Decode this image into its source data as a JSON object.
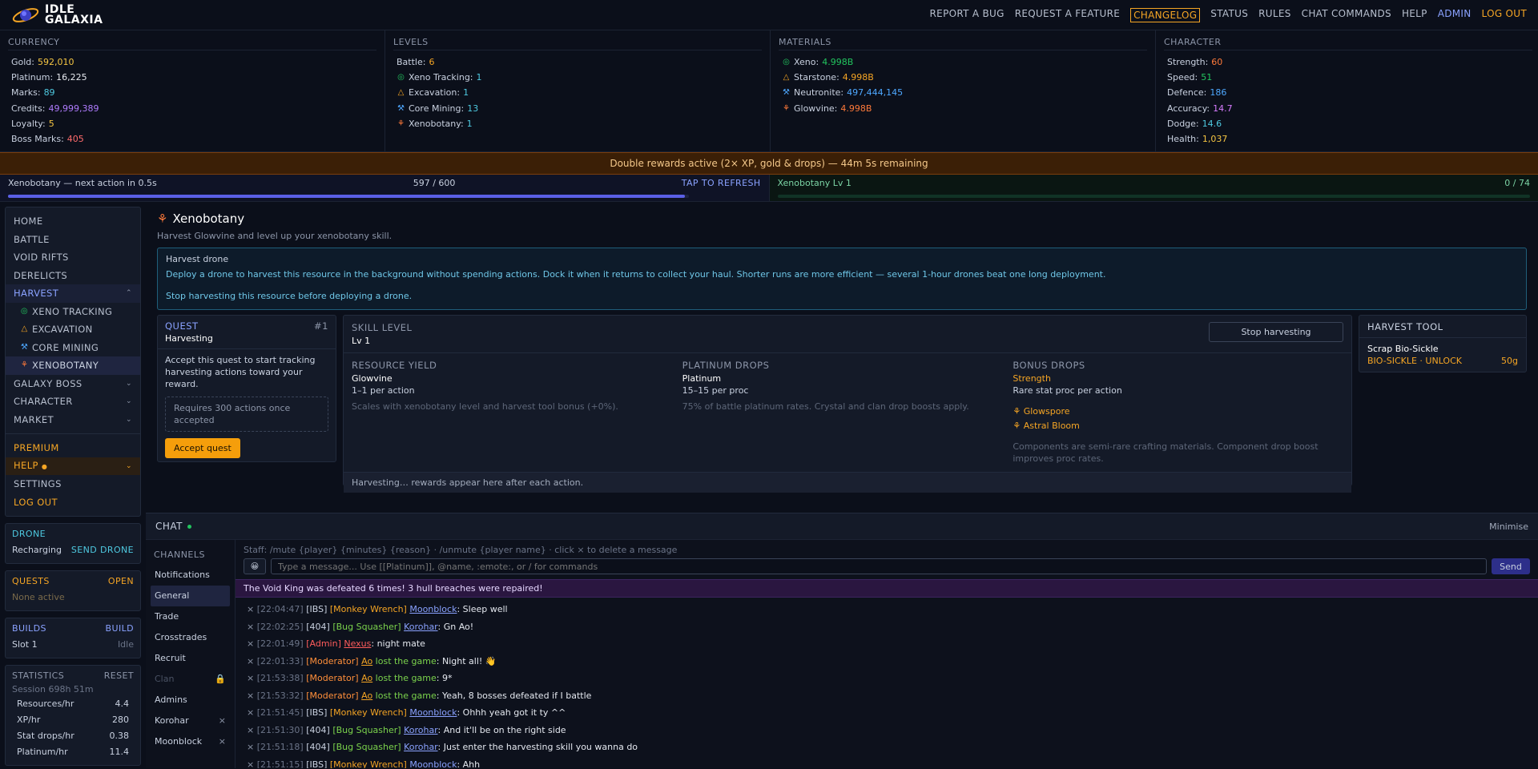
{
  "header": {
    "logo_line1": "IDLE",
    "logo_line2": "GALAXIA",
    "nav": [
      "REPORT A BUG",
      "REQUEST A FEATURE",
      "CHANGELOG",
      "STATUS",
      "RULES",
      "CHAT COMMANDS",
      "HELP",
      "ADMIN",
      "LOG OUT"
    ]
  },
  "stats": {
    "currency": {
      "title": "CURRENCY",
      "rows": [
        {
          "label": "Gold:",
          "value": "592,010",
          "color": "#f5c542"
        },
        {
          "label": "Platinum:",
          "value": "16,225",
          "color": "#e6e9ef"
        },
        {
          "label": "Marks:",
          "value": "89",
          "color": "#4ec9e0"
        },
        {
          "label": "Credits:",
          "value": "49,999,389",
          "color": "#b07cff"
        },
        {
          "label": "Loyalty:",
          "value": "5",
          "color": "#f5c542"
        },
        {
          "label": "Boss Marks:",
          "value": "405",
          "color": "#ff6b6b"
        }
      ]
    },
    "levels": {
      "title": "LEVELS",
      "rows": [
        {
          "label": "Battle:",
          "value": "6",
          "color": "#f5a524",
          "icon": ""
        },
        {
          "label": "Xeno Tracking:",
          "value": "1",
          "color": "#4ec9e0",
          "icon": "◎",
          "icon_color": "#22c55e"
        },
        {
          "label": "Excavation:",
          "value": "1",
          "color": "#4ec9e0",
          "icon": "△",
          "icon_color": "#f5a524"
        },
        {
          "label": "Core Mining:",
          "value": "13",
          "color": "#4ec9e0",
          "icon": "⚒",
          "icon_color": "#4ea8ff"
        },
        {
          "label": "Xenobotany:",
          "value": "1",
          "color": "#4ec9e0",
          "icon": "⚘",
          "icon_color": "#ff7a3a"
        }
      ]
    },
    "materials": {
      "title": "MATERIALS",
      "rows": [
        {
          "label": "Xeno:",
          "value": "4.998B",
          "color": "#22c55e",
          "icon": "◎",
          "icon_color": "#22c55e"
        },
        {
          "label": "Starstone:",
          "value": "4.998B",
          "color": "#f5a524",
          "icon": "△",
          "icon_color": "#f5a524"
        },
        {
          "label": "Neutronite:",
          "value": "497,444,145",
          "color": "#4ea8ff",
          "icon": "⚒",
          "icon_color": "#4ea8ff"
        },
        {
          "label": "Glowvine:",
          "value": "4.998B",
          "color": "#ff7a3a",
          "icon": "⚘",
          "icon_color": "#ff7a3a"
        }
      ]
    },
    "character": {
      "title": "CHARACTER",
      "rows": [
        {
          "label": "Strength:",
          "value": "60",
          "color": "#ff7a3a"
        },
        {
          "label": "Speed:",
          "value": "51",
          "color": "#22c55e"
        },
        {
          "label": "Defence:",
          "value": "186",
          "color": "#4ea8ff"
        },
        {
          "label": "Accuracy:",
          "value": "14.7",
          "color": "#d77cff"
        },
        {
          "label": "Dodge:",
          "value": "14.6",
          "color": "#4ec9e0"
        },
        {
          "label": "Health:",
          "value": "1,037",
          "color": "#f5c542"
        }
      ]
    }
  },
  "banner": "Double rewards active (2× XP, gold & drops) — 44m 5s remaining",
  "progress": {
    "left_label": "Xenobotany — next action in 0.5s",
    "left_count": "597 / 600",
    "left_fraction": 0.995,
    "left_action": "TAP TO REFRESH",
    "right_label": "Xenobotany Lv 1",
    "right_count": "0 / 74"
  },
  "sidebar": {
    "nav": [
      "HOME",
      "BATTLE",
      "VOID RIFTS",
      "DERELICTS"
    ],
    "harvest": "HARVEST",
    "harvest_items": [
      "XENO TRACKING",
      "EXCAVATION",
      "CORE MINING",
      "XENOBOTANY"
    ],
    "more": [
      "GALAXY BOSS",
      "CHARACTER",
      "MARKET"
    ],
    "premium": "PREMIUM",
    "help": "HELP",
    "settings": "SETTINGS",
    "logout": "LOG OUT",
    "drone": {
      "title": "DRONE",
      "status": "Recharging",
      "action": "SEND DRONE"
    },
    "quests": {
      "title": "QUESTS",
      "action": "OPEN",
      "status": "None active"
    },
    "builds": {
      "title": "BUILDS",
      "action": "BUILD",
      "slot": "Slot 1",
      "slot_status": "Idle"
    },
    "statistics": {
      "title": "STATISTICS",
      "action": "RESET",
      "session": "Session 698h 51m",
      "rows": [
        {
          "label": "Resources/hr",
          "value": "4.4"
        },
        {
          "label": "XP/hr",
          "value": "280"
        },
        {
          "label": "Stat drops/hr",
          "value": "0.38"
        },
        {
          "label": "Platinum/hr",
          "value": "11.4"
        }
      ]
    }
  },
  "page": {
    "title": "Xenobotany",
    "subtitle": "Harvest Glowvine and level up your xenobotany skill.",
    "drone_box": {
      "title": "Harvest drone",
      "line1": "Deploy a drone to harvest this resource in the background without spending actions. Dock it when it returns to collect your haul. Shorter runs are more efficient — several 1-hour drones beat one long deployment.",
      "line2": "Stop harvesting this resource before deploying a drone."
    },
    "quest": {
      "title": "QUEST",
      "num": "#1",
      "sub": "Harvesting",
      "desc": "Accept this quest to start tracking harvesting actions toward your reward.",
      "req": "Requires 300 actions once accepted",
      "button": "Accept quest"
    },
    "skill": {
      "title": "SKILL LEVEL",
      "level": "Lv 1",
      "stop_button": "Stop harvesting",
      "yield": {
        "h": "RESOURCE YIELD",
        "name": "Glowvine",
        "rate": "1–1 per action",
        "note": "Scales with xenobotany level and harvest tool bonus (+0%)."
      },
      "plat": {
        "h": "PLATINUM DROPS",
        "name": "Platinum",
        "rate": "15–15 per proc",
        "note": "75% of battle platinum rates. Crystal and clan drop boosts apply."
      },
      "bonus": {
        "h": "BONUS DROPS",
        "name": "Strength",
        "rate": "Rare stat proc per action",
        "item1": "Glowspore",
        "item2": "Astral Bloom",
        "note": "Components are semi-rare crafting materials. Component drop boost improves proc rates."
      },
      "footer": "Harvesting… rewards appear here after each action."
    },
    "tool": {
      "title": "HARVEST TOOL",
      "name": "Scrap Bio-Sickle",
      "unlock": "BIO-SICKLE · UNLOCK",
      "cost": "50g"
    }
  },
  "chat": {
    "title": "CHAT",
    "minimise": "Minimise",
    "channels_title": "CHANNELS",
    "channels": [
      "Notifications",
      "General",
      "Trade",
      "Crosstrades",
      "Recruit",
      "Clan",
      "Admins",
      "Korohar",
      "Moonblock"
    ],
    "staff_hint": "Staff: /mute {player} {minutes} {reason} · /unmute {player name} · click × to delete a message",
    "input_placeholder": "Type a message... Use [[Platinum]], @name, :emote:, or / for commands",
    "send": "Send",
    "system": "The Void King was defeated 6 times! 3 hull breaches were repaired!",
    "messages": [
      {
        "time": "[22:04:47]",
        "tag": "[IBS]",
        "role": "[Monkey Wrench]",
        "rc": "r-monkey",
        "user": "Moonblock",
        "uc": "u-moon",
        "text": ": Sleep well"
      },
      {
        "time": "[22:02:25]",
        "tag": "[404]",
        "role": "[Bug Squasher]",
        "rc": "r-bug",
        "user": "Korohar",
        "uc": "u-korohar",
        "text": ": Gn Ao!"
      },
      {
        "time": "[22:01:49]",
        "tag": "",
        "role": "[Admin]",
        "rc": "r-admin",
        "user": "Nexus",
        "uc": "u-nexus",
        "text": ": night mate"
      },
      {
        "time": "[22:01:33]",
        "tag": "",
        "role": "[Moderator]",
        "rc": "r-mod",
        "user": "Ao",
        "uc": "u-ao",
        "lost": "lost the game",
        "text": ": Night all! 👋"
      },
      {
        "time": "[21:53:38]",
        "tag": "",
        "role": "[Moderator]",
        "rc": "r-mod",
        "user": "Ao",
        "uc": "u-ao",
        "lost": "lost the game",
        "text": ": 9*"
      },
      {
        "time": "[21:53:32]",
        "tag": "",
        "role": "[Moderator]",
        "rc": "r-mod",
        "user": "Ao",
        "uc": "u-ao",
        "lost": "lost the game",
        "text": ": Yeah, 8 bosses defeated if I battle"
      },
      {
        "time": "[21:51:45]",
        "tag": "[IBS]",
        "role": "[Monkey Wrench]",
        "rc": "r-monkey",
        "user": "Moonblock",
        "uc": "u-moon",
        "text": ": Ohhh yeah got it ty ^^"
      },
      {
        "time": "[21:51:30]",
        "tag": "[404]",
        "role": "[Bug Squasher]",
        "rc": "r-bug",
        "user": "Korohar",
        "uc": "u-korohar",
        "text": ": And it'll be on the right side"
      },
      {
        "time": "[21:51:18]",
        "tag": "[404]",
        "role": "[Bug Squasher]",
        "rc": "r-bug",
        "user": "Korohar",
        "uc": "u-korohar",
        "text": ": Just enter the harvesting skill you wanna do"
      },
      {
        "time": "[21:51:15]",
        "tag": "[IBS]",
        "role": "[Monkey Wrench]",
        "rc": "r-monkey",
        "user": "Moonblock",
        "uc": "u-moon",
        "text": ": Ahh"
      }
    ]
  }
}
